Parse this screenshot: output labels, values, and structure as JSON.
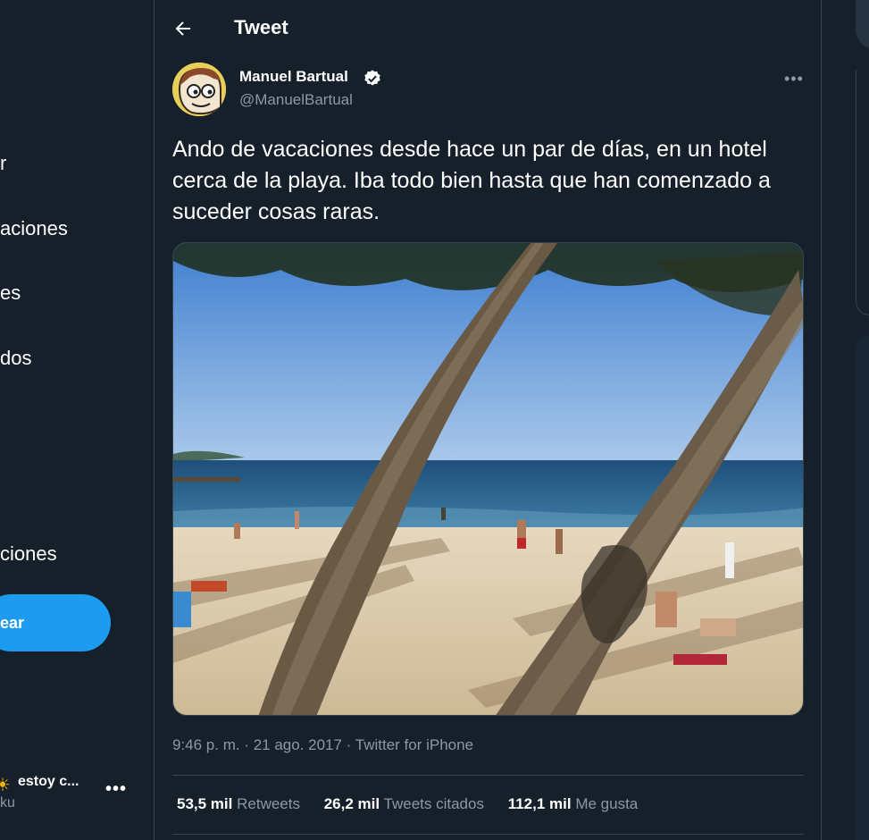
{
  "sidebar": {
    "items": [
      {
        "label": "r"
      },
      {
        "label": "aciones"
      },
      {
        "label": "es"
      },
      {
        "label": "dos"
      },
      {
        "label": "ciones"
      }
    ],
    "tweet_button": "ear",
    "account": {
      "name": "estoy c...",
      "handle": "ku",
      "more": "•••"
    }
  },
  "header": {
    "title": "Tweet",
    "back_icon": "arrow-left-icon"
  },
  "tweet": {
    "author_name": "Manuel Bartual",
    "author_handle": "@ManuelBartual",
    "verified_icon": "verified-badge-icon",
    "more": "•••",
    "text": "Ando de vacaciones desde hace un par de días, en un hotel cerca de la playa. Iba todo bien hasta que han comenzado a suceder cosas raras.",
    "timestamp": "9:46 p. m. · 21 ago. 2017 · Twitter for iPhone",
    "stats": [
      {
        "count": "53,5 mil",
        "label": "Retweets"
      },
      {
        "count": "26,2 mil",
        "label": "Tweets citados"
      },
      {
        "count": "112,1 mil",
        "label": "Me gusta"
      }
    ]
  },
  "colors": {
    "background": "#15202b",
    "accent": "#1d9bf0",
    "muted": "#8b98a5",
    "border": "#38444d"
  }
}
